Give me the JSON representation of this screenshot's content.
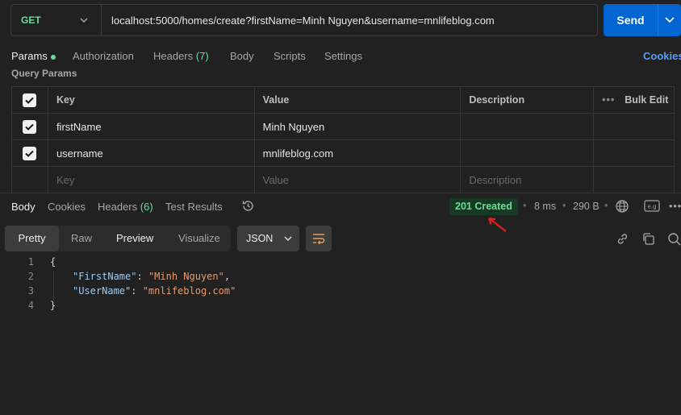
{
  "request": {
    "method": "GET",
    "url": "localhost:5000/homes/create?firstName=Minh Nguyen&username=mnlifeblog.com",
    "send_label": "Send"
  },
  "request_tabs": {
    "params": "Params",
    "authorization": "Authorization",
    "headers": "Headers",
    "headers_count": "(7)",
    "body": "Body",
    "scripts": "Scripts",
    "settings": "Settings",
    "cookies": "Cookies"
  },
  "query_params": {
    "title": "Query Params",
    "columns": {
      "key": "Key",
      "value": "Value",
      "description": "Description",
      "bulk_edit": "Bulk Edit"
    },
    "rows": [
      {
        "key": "firstName",
        "value": "Minh Nguyen",
        "description": "",
        "checked": true
      },
      {
        "key": "username",
        "value": "mnlifeblog.com",
        "description": "",
        "checked": true
      }
    ],
    "placeholder": {
      "key": "Key",
      "value": "Value",
      "description": "Description"
    }
  },
  "response_tabs": {
    "body": "Body",
    "cookies": "Cookies",
    "headers": "Headers",
    "headers_count": "(6)",
    "test_results": "Test Results"
  },
  "response_meta": {
    "status": "201 Created",
    "time": "8 ms",
    "size": "290 B",
    "status_color": "#6bdd9a",
    "annotation_arrow_color": "#e02020"
  },
  "format": {
    "pretty": "Pretty",
    "raw": "Raw",
    "preview": "Preview",
    "visualize": "Visualize",
    "type": "JSON"
  },
  "response_body": {
    "line_numbers": [
      "1",
      "2",
      "3",
      "4"
    ],
    "open_brace": "{",
    "close_brace": "}",
    "fields": [
      {
        "key": "\"FirstName\"",
        "value": "\"Minh Nguyen\"",
        "trail": ","
      },
      {
        "key": "\"UserName\"",
        "value": "\"mnlifeblog.com\"",
        "trail": ""
      }
    ]
  },
  "colors": {
    "accent": "#0265d2",
    "method_get": "#6bdd9a",
    "json_key": "#9cc8f2",
    "json_string": "#e79b6a"
  }
}
